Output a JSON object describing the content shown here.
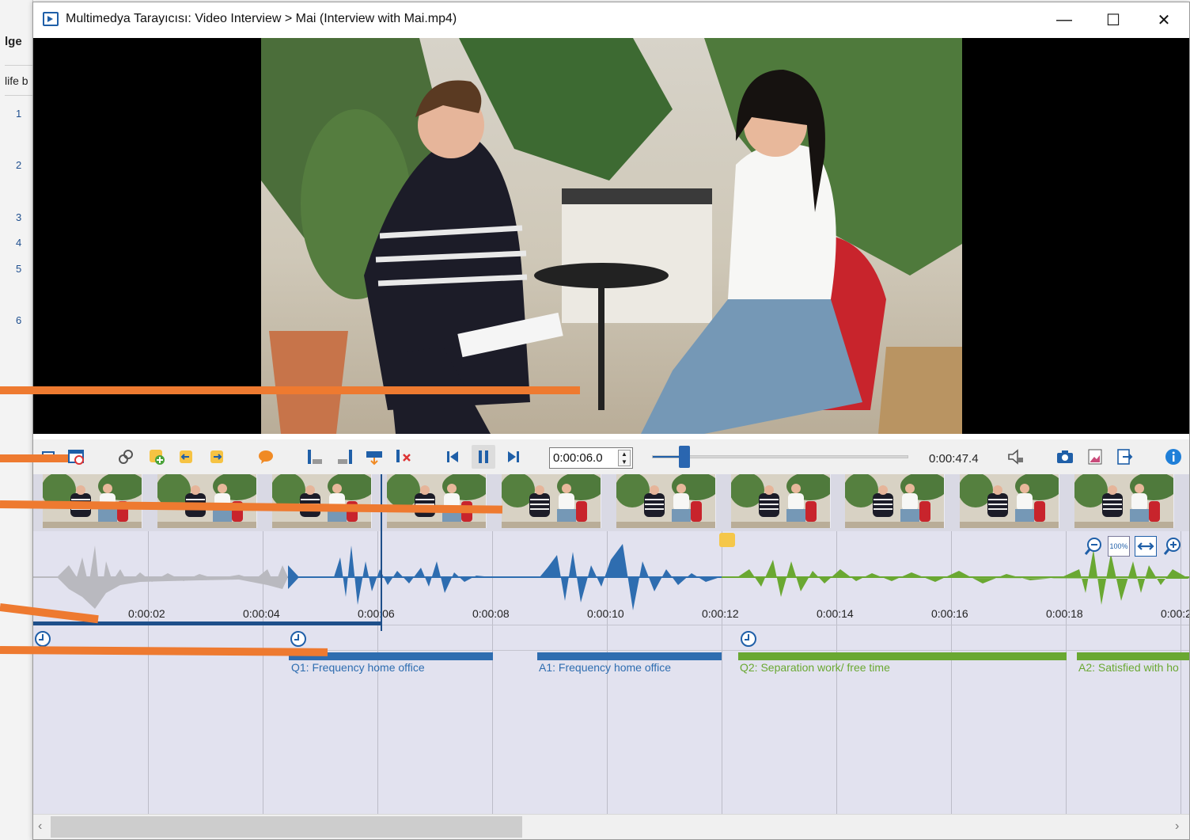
{
  "background_doc": {
    "fragments": [
      "lge",
      "life b"
    ],
    "row_numbers": [
      "1",
      "2",
      "3",
      "4",
      "5",
      "6"
    ]
  },
  "window": {
    "title": "Multimedya Tarayıcısı: Video Interview > Mai (Interview with Mai.mp4)",
    "controls": {
      "minimize": "—",
      "maximize": "☐",
      "close": "✕"
    }
  },
  "player": {
    "current_time": "0:00:06.0",
    "duration": "0:00:47.4",
    "position_fraction": 0.127,
    "toolbar_icons": [
      "segment-list-icon",
      "video-settings-icon",
      "link-icon",
      "add-segment-icon",
      "segment-start-icon",
      "segment-end-icon",
      "comment-icon",
      "set-start-icon",
      "set-end-icon",
      "loop-icon",
      "delete-segment-icon",
      "previous-icon",
      "pause-icon",
      "next-icon",
      "volume-icon",
      "snapshot-icon",
      "export-image-icon",
      "export-icon",
      "info-icon"
    ]
  },
  "timeline": {
    "ticks": [
      "0:00:02",
      "0:00:04",
      "0:00:06",
      "0:00:08",
      "0:00:10",
      "0:00:12",
      "0:00:14",
      "0:00:16",
      "0:00:18",
      "0:00:2"
    ],
    "zoom_label": "100%",
    "segments": [
      {
        "label": "Q1: Frequency home office",
        "color": "#2e6db0"
      },
      {
        "label": "A1: Frequency home office",
        "color": "#2e6db0"
      },
      {
        "label": "Q2: Separation work/ free time",
        "color": "#6aa832"
      },
      {
        "label": "A2: Satisfied with ho",
        "color": "#6aa832"
      }
    ],
    "colors": {
      "gray": "#b9b9bf",
      "blue": "#2e6db0",
      "green": "#6aa832",
      "accent": "#ee7a30",
      "memo": "#f5c74a"
    }
  },
  "scrollbar": {
    "left": "‹",
    "right": "›"
  }
}
